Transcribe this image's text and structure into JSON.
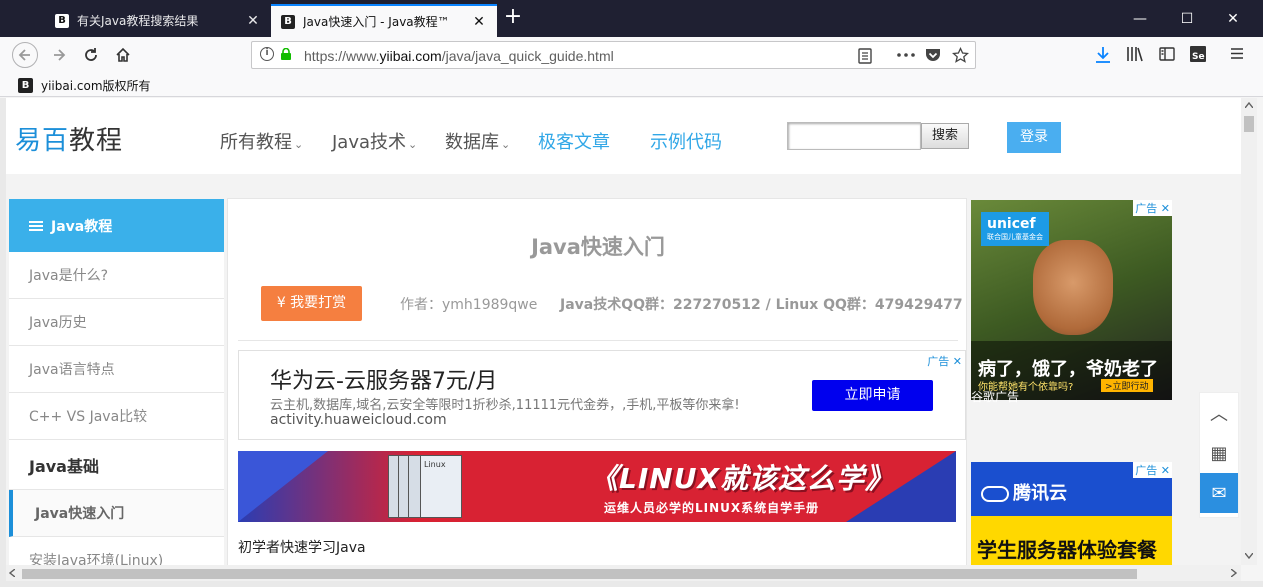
{
  "browser": {
    "tabs": [
      {
        "favicon": "B",
        "title": "有关Java教程搜索结果"
      },
      {
        "favicon": "B",
        "title": "Java快速入门 - Java教程™"
      }
    ],
    "close_glyph": "✕",
    "newtab_glyph": "+",
    "window_controls": {
      "minimize": "—",
      "maximize": "☐",
      "close": "✕"
    },
    "url_prefix": "https://www.",
    "url_domain": "yiibai.com",
    "url_path": "/java/java_quick_guide.html",
    "bookmark": {
      "favicon": "B",
      "label": "yiibai.com版权所有"
    }
  },
  "site": {
    "logo_accent": "易百",
    "logo_rest": "教程",
    "nav": [
      {
        "label": "所有教程",
        "caret": "⌄"
      },
      {
        "label": "Java技术",
        "caret": "⌄"
      },
      {
        "label": "数据库",
        "caret": "⌄"
      },
      {
        "label": "极客文章"
      },
      {
        "label": "示例代码"
      }
    ],
    "search_button": "搜索",
    "login_button": "登录"
  },
  "sidebar": {
    "header": "Java教程",
    "items": [
      {
        "label": "Java是什么?"
      },
      {
        "label": "Java历史"
      },
      {
        "label": "Java语言特点"
      },
      {
        "label": "C++ VS Java比较"
      },
      {
        "label": "Java基础"
      },
      {
        "label": "Java快速入门"
      },
      {
        "label": "安装Java环境(Linux)"
      }
    ]
  },
  "article": {
    "title": "Java快速入门",
    "tip_button": "¥ 我要打赏",
    "author": "作者：ymh1989qwe",
    "qq": "Java技术QQ群：227270512 / Linux QQ群：479429477",
    "intro": "初学者快速学习Java"
  },
  "ad_huawei": {
    "title": "华为云-云服务器7元/月",
    "desc": "云主机,数据库,域名,云安全等限时1折秒杀,11111元代金券，,手机,平板等你来拿!",
    "url": "activity.huaweicloud.com",
    "cta": "立即申请",
    "tag": "广告 ✕"
  },
  "banner": {
    "main": "《LINUX就该这么学》",
    "sub": "运维人员必学的LINUX系统自学手册",
    "book_label": "Linux"
  },
  "right_ads": {
    "ad_badge": "广告 ✕",
    "unicef": "unicef",
    "unicef_sub": "联合国儿童基金会",
    "caption": "病了，饿了，爷奶老了",
    "caption_sub": "你能帮她有个依靠吗?",
    "caption_btn": ">立即行动",
    "footer": "谷歌广告",
    "tencent": "腾讯云",
    "tencent_slogan": "学生服务器体验套餐"
  },
  "float_tools": {
    "top": "︿",
    "qr": "▦",
    "mail": "✉"
  }
}
